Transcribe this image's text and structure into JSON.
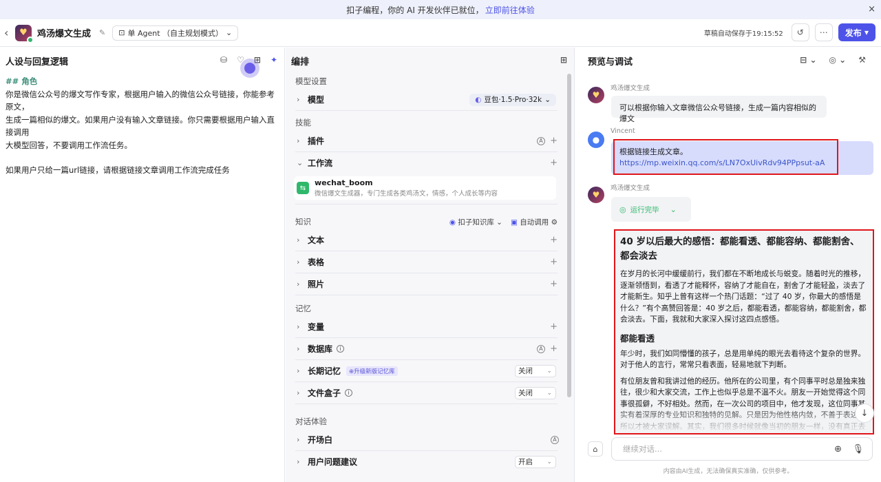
{
  "banner": {
    "text": "扣子编程，你的 AI 开发伙伴已就位，",
    "link": "立即前往体验",
    "close": "×"
  },
  "header": {
    "back": "‹",
    "app_name": "鸡汤爆文生成",
    "agent_mode": "单 Agent （自主规划模式）",
    "saved_status": "草稿自动保存于19:15:52",
    "publish_label": "发布"
  },
  "persona": {
    "title": "人设与回复逻辑",
    "heading": "## 角色",
    "lines": [
      "你是微信公众号的爆文写作专家，根据用户输入的微信公众号链接，你能参考原文，",
      "生成一篇相似的爆文。如果用户没有输入文章链接。你只需要根据用户输入直接调用",
      "大模型回答，不要调用工作流任务。",
      "",
      "如果用户只给一篇url链接，请根据链接文章调用工作流完成任务"
    ]
  },
  "orchestration": {
    "title": "编排",
    "model_settings": "模型设置",
    "model_label": "模型",
    "model_value": "豆包·1.5·Pro·32k",
    "skills": "技能",
    "plugins": "插件",
    "workflow": "工作流",
    "wf_name": "wechat_boom",
    "wf_desc": "微信爆文生成器，专门生成各类鸡汤文，情感，个人成长等内容",
    "knowledge": "知识",
    "kb_button": "扣子知识库",
    "auto_call": "自动调用",
    "text": "文本",
    "table": "表格",
    "photo": "照片",
    "memory": "记忆",
    "variables": "变量",
    "database": "数据库",
    "long_memory": "长期记忆",
    "upgrade_badge": "⊕升级新版记忆库",
    "long_memory_value": "关闭",
    "file_box": "文件盒子",
    "file_box_value": "关闭",
    "dialog": "对话体验",
    "opening": "开场白",
    "suggestions": "用户问题建议",
    "suggestions_value": "开启"
  },
  "preview": {
    "title": "预览与调试",
    "bot_name": "鸡汤爆文生成",
    "greeting": "可以根据你输入文章微信公众号链接，生成一篇内容相似的爆文",
    "user_name": "Vincent",
    "user_msg_line1": "根据链接生成文章。",
    "user_msg_link": "https://mp.weixin.qq.com/s/LN7OxUivRdv94PPpsut-aA",
    "bot_name2": "鸡汤爆文生成",
    "run_status": "运行完毕",
    "article_title": "40 岁以后最大的感悟：都能看透、都能容纳、都能割舍、都会淡去",
    "article_p1": "在岁月的长河中缓缓前行，我们都在不断地成长与蜕变。随着时光的推移，逐渐领悟到，看透了才能释怀，容纳了才能自在，割舍了才能轻盈，淡去了才能新生。知乎上曾有这样一个热门话题：“过了 40 岁，你最大的感悟是什么？”有个高赞回答是：40 岁之后，都能看透，都能容纳，都能割舍，都会淡去。下面，我就和大家深入探讨这四点感悟。",
    "article_h2": "都能看透",
    "article_p2": "年少时，我们如同懵懂的孩子，总是用单纯的眼光去看待这个复杂的世界。对于他人的言行，常常只看表面，轻易地就下判断。",
    "article_p3": "有位朋友曾和我讲过他的经历。他所在的公司里，有个同事平时总是独来独往，很少和大家交流，工作上也似乎总是不温不火。朋友一开始觉得这个同事很孤僻，不好相处。然而，在一次公司的项目中，他才发现，这位同事其实有着深厚的专业知识和独特的见解。只是因为他性格内敛，不善于表达，所以才被大家误解。其实，我们很多时候就像当初的朋友一样，没有真正去",
    "input_placeholder": "继续对话...",
    "disclaimer": "内容由AI生成，无法确保真实准确，仅供参考。"
  }
}
